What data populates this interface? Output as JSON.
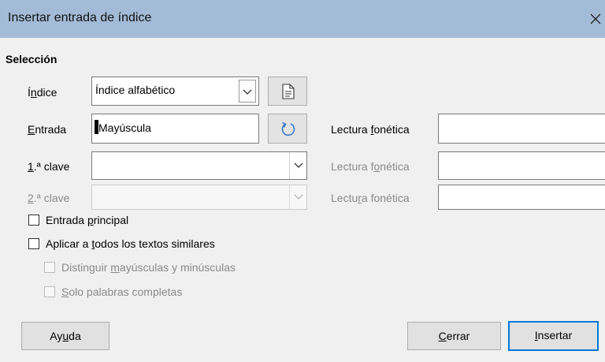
{
  "window": {
    "title": "Insertar entrada de índice",
    "close_icon": "close-icon"
  },
  "selection": {
    "heading": "Selección",
    "index": {
      "label_pre": "Í",
      "label_acc": "n",
      "label_post": "dice",
      "value": "Índice alfabético"
    },
    "entry": {
      "label_acc": "E",
      "label_post": "ntrada",
      "value": "Mayúscula",
      "phonetic": {
        "label_pre": "Lectura ",
        "label_acc": "f",
        "label_post": "onética",
        "value": ""
      }
    },
    "key1": {
      "label_acc": "1",
      "label_post": ".ª clave",
      "value": "",
      "phonetic": {
        "label_pre": "Lectura f",
        "label_acc": "o",
        "label_post": "nética",
        "value": ""
      }
    },
    "key2": {
      "label_acc": "2",
      "label_post": ".ª clave",
      "value": "",
      "phonetic": {
        "label_pre": "Lectu",
        "label_acc": "r",
        "label_post": "a fonética",
        "value": ""
      }
    }
  },
  "options": {
    "main_entry": {
      "pre": "Entrada ",
      "acc": "p",
      "post": "rincipal",
      "checked": false
    },
    "apply_all": {
      "pre": "Aplicar a ",
      "acc": "t",
      "post": "odos los textos similares",
      "checked": false
    },
    "match_case": {
      "pre": "Distinguir ",
      "acc": "m",
      "post": "ayúsculas y minúsculas",
      "checked": false
    },
    "whole_words": {
      "pre": "",
      "acc": "S",
      "post": "olo palabras completas",
      "checked": false
    }
  },
  "buttons": {
    "help": {
      "pre": "Ay",
      "acc": "u",
      "post": "da"
    },
    "close": {
      "pre": "",
      "acc": "C",
      "post": "errar"
    },
    "insert": {
      "pre": "",
      "acc": "I",
      "post": "nsertar"
    }
  },
  "colors": {
    "titlebar": "#a3bbd6",
    "focus": "#0078d7",
    "refresh_icon": "#3a78c9"
  }
}
